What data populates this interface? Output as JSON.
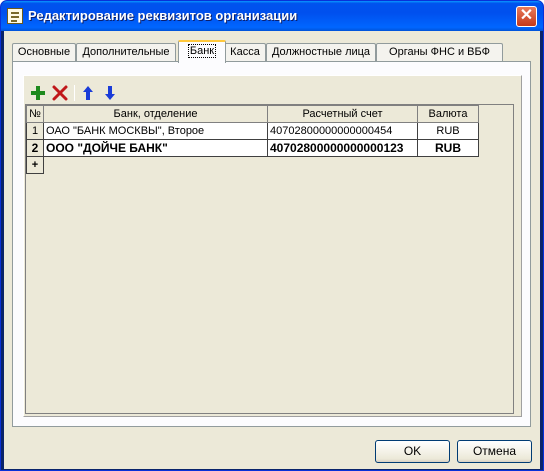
{
  "window": {
    "title": "Редактирование реквизитов организации"
  },
  "tabs": [
    {
      "label": "Основные"
    },
    {
      "label": "Дополнительные"
    },
    {
      "label": "Банк"
    },
    {
      "label": "Касса"
    },
    {
      "label": "Должностные лица"
    },
    {
      "label": "Органы ФНС и ВБФ"
    }
  ],
  "active_tab": "Банк",
  "toolbar": {
    "add_icon": "plus-icon",
    "delete_icon": "x-icon",
    "up_icon": "arrow-up-icon",
    "down_icon": "arrow-down-icon",
    "add_color": "#1e8a1e",
    "delete_color": "#c0181a",
    "arrow_color": "#1a3cd8"
  },
  "table": {
    "headers": [
      "№",
      "Банк, отделение",
      "Расчетный счет",
      "Валюта"
    ],
    "rows": [
      {
        "num": "1",
        "bank": "ОАО \"БАНК МОСКВЫ\", Второе",
        "account": "40702800000000000454",
        "currency": "RUB"
      },
      {
        "num": "2",
        "bank": "ООО \"ДОЙЧЕ БАНК\"",
        "account": "40702800000000000123",
        "currency": "RUB"
      }
    ],
    "new_row_marker": "+"
  },
  "buttons": {
    "ok": "OK",
    "cancel": "Отмена"
  }
}
